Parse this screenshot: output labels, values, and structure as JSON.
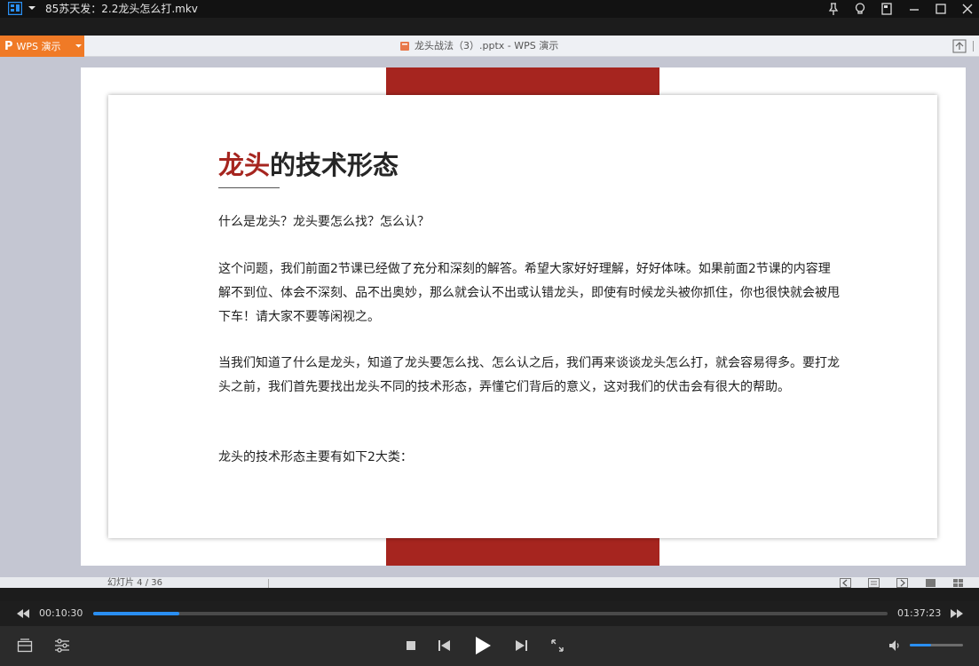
{
  "player": {
    "title": "85苏天发：2.2龙头怎么打.mkv",
    "current_time": "00:10:30",
    "total_time": "01:37:23",
    "progress_fraction": 0.108,
    "volume_fraction": 0.4,
    "accent_color": "#2a8ff2"
  },
  "wps": {
    "app_label": "WPS 演示",
    "document_title": "龙头战法（3）.pptx - WPS 演示",
    "status_slide_count": "幻灯片 4 / 36",
    "brand_color": "#f07a26"
  },
  "slide": {
    "title_accent": "龙头",
    "title_rest": "的技术形态",
    "accent_color": "#a6251f",
    "paragraphs": [
      "什么是龙头？龙头要怎么找？怎么认？",
      "这个问题，我们前面2节课已经做了充分和深刻的解答。希望大家好好理解，好好体味。如果前面2节课的内容理解不到位、体会不深刻、品不出奥妙，那么就会认不出或认错龙头，即使有时候龙头被你抓住，你也很快就会被甩下车！请大家不要等闲视之。",
      "当我们知道了什么是龙头，知道了龙头要怎么找、怎么认之后，我们再来谈谈龙头怎么打，就会容易得多。要打龙头之前，我们首先要找出龙头不同的技术形态，弄懂它们背后的意义，这对我们的伏击会有很大的帮助。",
      "龙头的技术形态主要有如下2大类："
    ]
  }
}
